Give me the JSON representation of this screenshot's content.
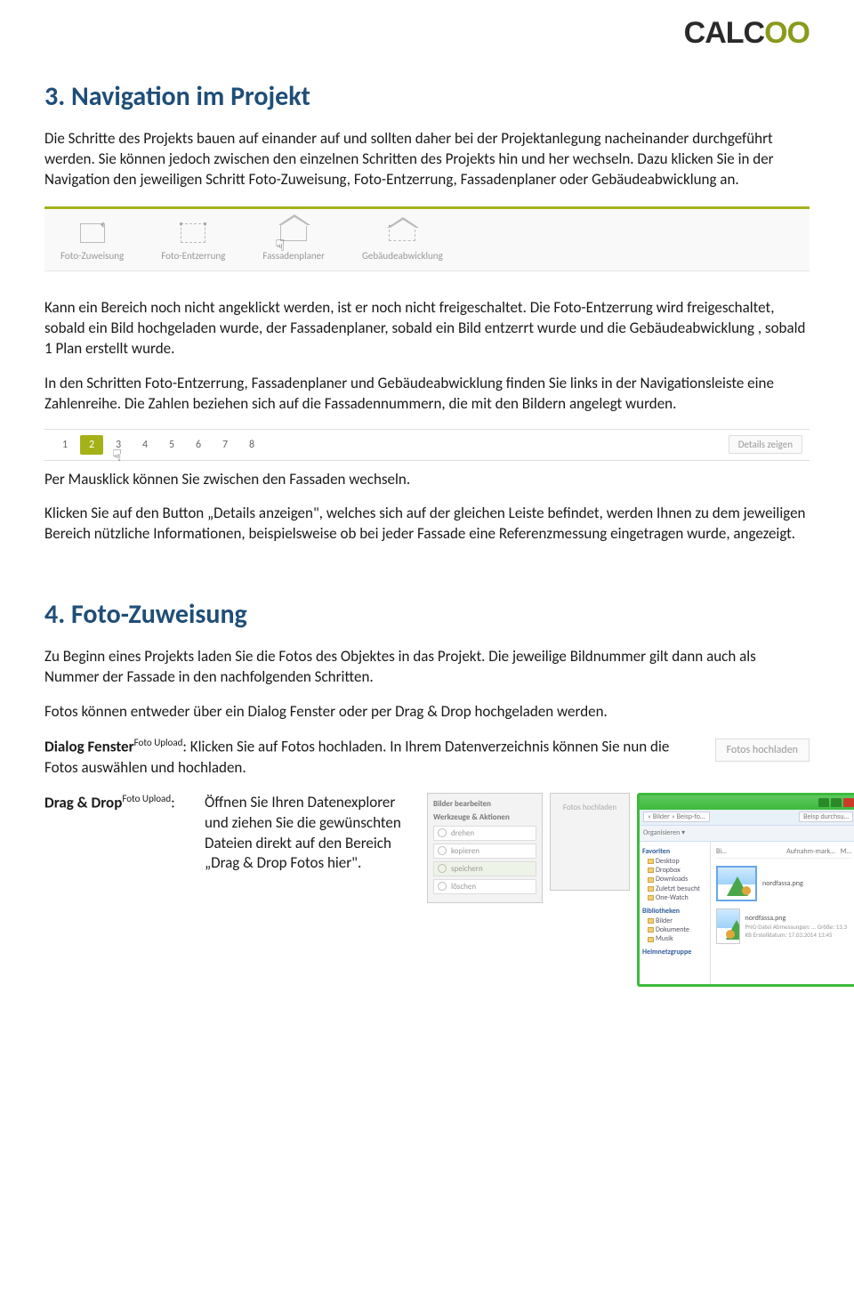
{
  "logo": {
    "part1": "CAL",
    "part2": "C",
    "part3": "OO"
  },
  "sections": {
    "nav": {
      "title": "3. Navigation im Projekt",
      "p1": "Die Schritte des Projekts bauen auf einander auf und sollten daher bei der Projektanlegung nacheinander durchgeführt werden. Sie können jedoch zwischen den einzelnen Schritten des Projekts hin und her wechseln. Dazu klicken Sie in der Navigation den jeweiligen Schritt Foto-Zuweisung, Foto-Entzerrung, Fassadenplaner oder Gebäudeabwicklung an.",
      "tabs": [
        "Foto-Zuweisung",
        "Foto-Entzerrung",
        "Fassadenplaner",
        "Gebäudeabwicklung"
      ],
      "p2": "Kann ein Bereich noch nicht angeklickt werden, ist er noch nicht freigeschaltet. Die Foto-Entzerrung wird freigeschaltet, sobald ein Bild hochgeladen wurde, der Fassadenplaner, sobald ein Bild entzerrt wurde und die Gebäudeabwicklung , sobald 1 Plan erstellt wurde.",
      "p3": "In den Schritten Foto-Entzerrung, Fassadenplaner und Gebäudeabwicklung finden Sie links in der Navigationsleiste eine Zahlenreihe. Die Zahlen beziehen sich auf die Fassadennummern, die mit den Bildern angelegt wurden.",
      "numbers": [
        "1",
        "2",
        "3",
        "4",
        "5",
        "6",
        "7",
        "8"
      ],
      "active_number_index": 1,
      "details_btn": "Details zeigen",
      "p4": "Per Mausklick können Sie zwischen den Fassaden wechseln.",
      "p5": "Klicken Sie auf den Button „Details anzeigen\", welches sich auf der gleichen Leiste befindet, werden Ihnen zu dem jeweiligen Bereich nützliche Informationen, beispielsweise ob bei jeder Fassade eine Referenzmessung eingetragen wurde, angezeigt."
    },
    "foto": {
      "title": "4. Foto-Zuweisung",
      "p1": "Zu Beginn eines Projekts laden Sie die Fotos des Objektes in das Projekt. Die jeweilige Bildnummer gilt dann auch als Nummer der Fassade in den nachfolgenden Schritten.",
      "p2": "Fotos können entweder über ein Dialog Fenster oder per Drag & Drop hochgeladen werden.",
      "dialog": {
        "lead": "Dialog Fenster",
        "sup": "Foto Upload",
        "text": ": Klicken Sie auf Fotos hochladen. In Ihrem Datenverzeichnis können Sie nun die Fotos auswählen und hochladen.",
        "btn": "Fotos hochladen"
      },
      "dragdrop": {
        "lead": "Drag & Drop",
        "sup": "Foto Upload",
        "colon": ":",
        "text": "Öffnen Sie Ihren Datenexplorer und ziehen Sie die gewünschten Dateien direkt auf den Bereich „Drag & Drop Fotos hier\"."
      },
      "mock": {
        "panel_hdr1": "Bilder bearbeiten",
        "panel_hdr2": "Werkzeuge & Aktionen",
        "tools": [
          "drehen",
          "kopieren",
          "speichern",
          "löschen"
        ],
        "drop_label": "Fotos hochladen",
        "explorer": {
          "crumb": "« Bilder » Beisp-fo…",
          "search": "Beisp durchsu…",
          "organize": "Organisieren ▾",
          "tree": {
            "fav": "Favoriten",
            "fav_items": [
              "Desktop",
              "Dropbox",
              "Downloads",
              "Zuletzt besucht",
              "One-Watch"
            ],
            "lib": "Bibliotheken",
            "lib_items": [
              "Bilder",
              "Dokumente",
              "Musik"
            ],
            "home": "Heimnetzgruppe"
          },
          "files": [
            {
              "name": "nordfassa.png",
              "sub": ""
            },
            {
              "name": "nordfassa.png",
              "sub": "PNG-Datei\nAbmessungen: …\nGröße: 13,3 KB\nErstelldatum: 17.03.2014 13:45"
            }
          ],
          "col_name": "Bi…",
          "col_date": "Aufnahm-mark…",
          "col_tag": "M…"
        }
      }
    }
  }
}
